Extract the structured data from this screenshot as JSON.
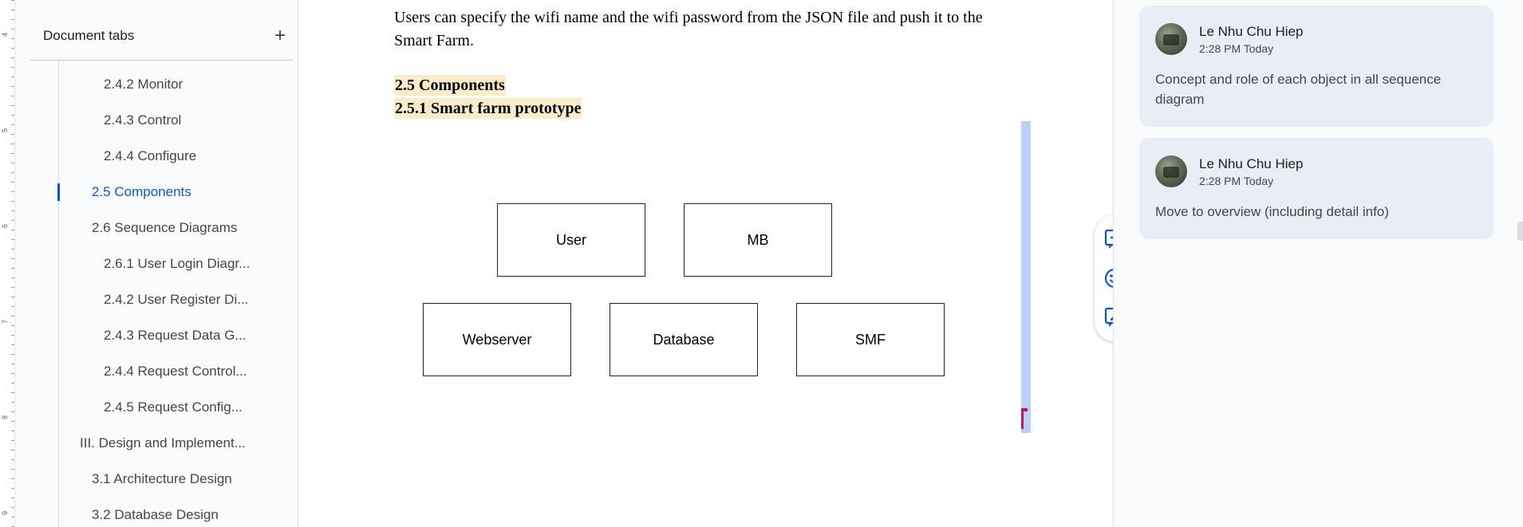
{
  "outline": {
    "title": "Document tabs",
    "add_label": "+",
    "items": [
      {
        "label": "2.4.2 Monitor"
      },
      {
        "label": "2.4.3 Control"
      },
      {
        "label": "2.4.4 Configure"
      },
      {
        "label": "2.5 Components"
      },
      {
        "label": "2.6 Sequence Diagrams"
      },
      {
        "label": "2.6.1 User Login Diagr..."
      },
      {
        "label": "2.4.2 User Register Di..."
      },
      {
        "label": "2.4.3 Request Data G..."
      },
      {
        "label": "2.4.4 Request Control..."
      },
      {
        "label": "2.4.5 Request Config..."
      },
      {
        "label": "III. Design and Implement..."
      },
      {
        "label": "3.1 Architecture Design"
      },
      {
        "label": "3.2 Database Design"
      }
    ],
    "active_item": "2.5 Components"
  },
  "ruler": {
    "numbers": [
      "4",
      "5",
      "6",
      "7",
      "8",
      "9"
    ]
  },
  "document": {
    "paragraph": "Users can specify the wifi name and the wifi password from the JSON file and push it to the Smart Farm.",
    "heading_1": "2.5 Components",
    "heading_2": "2.5.1 Smart farm prototype",
    "diagram": {
      "boxes": [
        "User",
        "MB",
        "Webserver",
        "Database",
        "SMF"
      ]
    }
  },
  "actions": {
    "icons": [
      "add-comment-icon",
      "emoji-reaction-icon",
      "suggest-edit-icon"
    ]
  },
  "comments": [
    {
      "author": "Le Nhu Chu Hiep",
      "time": "2:28 PM Today",
      "text": "Concept and role of each object in all sequence diagram"
    },
    {
      "author": "Le Nhu Chu Hiep",
      "time": "2:28 PM Today",
      "text": "Move to overview (including detail info)"
    }
  ],
  "colors": {
    "accent": "#0b57d0",
    "highlight": "#fbecc9",
    "comment_bg": "#e9eef6"
  }
}
